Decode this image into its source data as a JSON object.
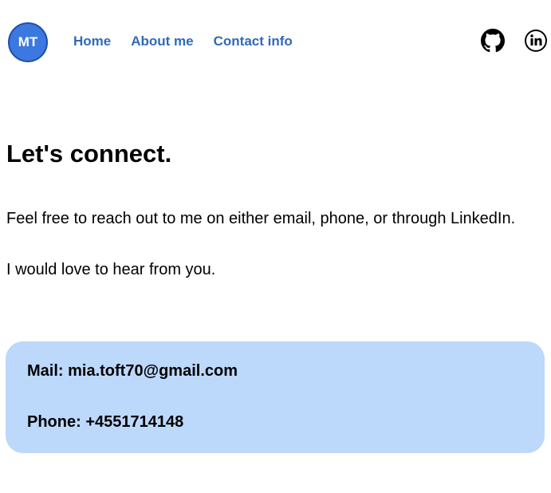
{
  "header": {
    "logo_text": "MT",
    "nav": [
      {
        "label": "Home"
      },
      {
        "label": "About me"
      },
      {
        "label": "Contact info"
      }
    ],
    "social_icons": [
      "github-icon",
      "linkedin-icon"
    ]
  },
  "main": {
    "heading": "Let's connect.",
    "paragraph1": "Feel free to reach out to me on either email, phone, or through LinkedIn.",
    "paragraph2": "I would love to hear from you."
  },
  "contact": {
    "mail": "Mail: mia.toft70@gmail.com",
    "phone": "Phone: +4551714148"
  },
  "colors": {
    "logo_bg": "#3b78e0",
    "nav_link": "#2f6ab8",
    "card_bg": "#bcd8fb"
  }
}
